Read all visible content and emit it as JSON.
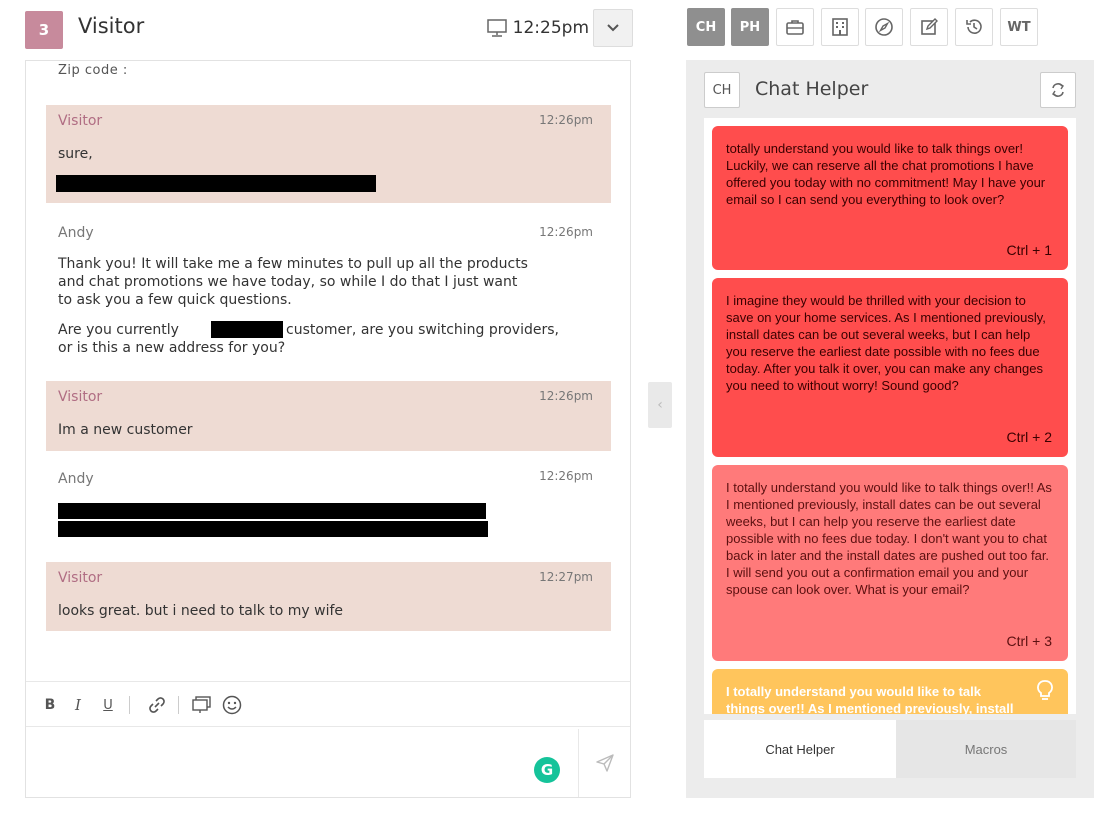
{
  "header": {
    "badge": "3",
    "title": "Visitor",
    "time": "12:25pm"
  },
  "chat": {
    "cut_off_text": "Zip code :",
    "messages": [
      {
        "sender": "Visitor",
        "time": "12:26pm",
        "text": "sure,"
      },
      {
        "sender": "Andy",
        "time": "12:26pm",
        "lines": [
          "Thank you! It will take me a few minutes to pull up all the products",
          "and chat promotions we have today, so while I do that I just want",
          "to ask you a few quick questions."
        ],
        "lines2_a": "Are you currently",
        "lines2_b": "customer, are you switching providers,",
        "lines2_c": "or is this a new address for you?"
      },
      {
        "sender": "Visitor",
        "time": "12:26pm",
        "text": "Im a new customer"
      },
      {
        "sender": "Andy",
        "time": "12:26pm"
      },
      {
        "sender": "Visitor",
        "time": "12:27pm",
        "text": "looks great. but i need to talk to my wife"
      }
    ],
    "toolbar": {
      "bold": "B",
      "italic": "I",
      "underline": "U"
    },
    "compose_placeholder": "",
    "grammarly": "G"
  },
  "tools": [
    "CH",
    "PH",
    "briefcase-icon",
    "building-icon",
    "compass-icon",
    "edit-icon",
    "history-icon",
    "WT"
  ],
  "tool_labels": {
    "ch": "CH",
    "ph": "PH",
    "wt": "WT"
  },
  "helper": {
    "badge": "CH",
    "title": "Chat Helper",
    "cards": [
      {
        "text": "totally understand you would like to talk things over! Luckily, we can reserve all the chat promotions I have offered you today with no commitment! May I have your email so I can send you everything to look over?",
        "shortcut": "Ctrl + 1",
        "color": "#ff4d4d"
      },
      {
        "text": "I imagine they would be thrilled with your decision to save on your home services. As I mentioned previously, install dates can be out several weeks, but I can help you reserve the earliest date possible with no fees due today. After you talk it over, you can make any changes you need to without worry! Sound good?",
        "shortcut": "Ctrl + 2",
        "color": "#ff4d4d"
      },
      {
        "text": "I totally understand you would like to talk things over!! As I mentioned previously, install dates can be out several weeks, but I can help you reserve the earliest date possible with no fees due today. I don't want you to chat back in later and the install dates are pushed out too far. I will send you out a confirmation email you and your spouse can look over. What is your email?",
        "shortcut": "Ctrl + 3",
        "color": "#ff7a7a"
      },
      {
        "text": "I totally understand you would like to talk things over!! As I mentioned previously, install",
        "color": "#ffc55c"
      }
    ],
    "tabs": {
      "active": "Chat Helper",
      "inactive": "Macros"
    }
  }
}
